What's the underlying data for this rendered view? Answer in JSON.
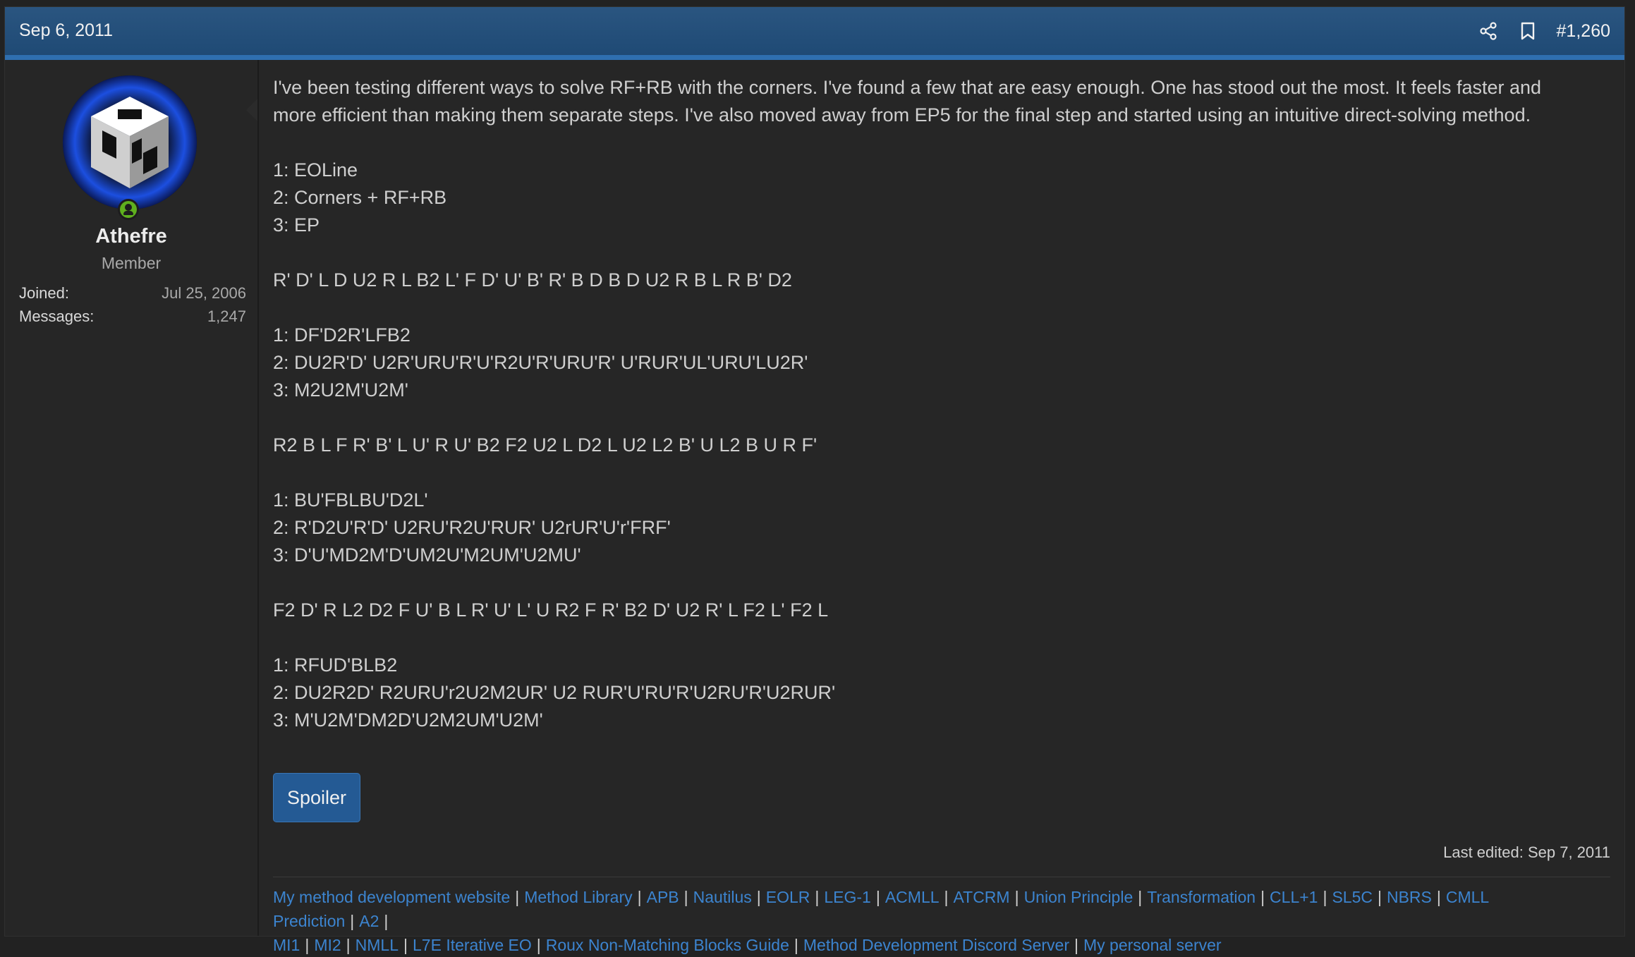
{
  "header": {
    "date": "Sep 6, 2011",
    "post_number": "#1,260",
    "share_icon": "share-icon",
    "bookmark_icon": "bookmark-icon",
    "bar_color": "#215080",
    "accent_color": "#2f6fb0"
  },
  "user": {
    "name": "Athefre",
    "title": "Member",
    "joined_label": "Joined:",
    "joined_value": "Jul 25, 2006",
    "messages_label": "Messages:",
    "messages_value": "1,247",
    "online_status_color": "#5fb01e"
  },
  "post": {
    "intro_line1": "I've been testing different ways to solve RF+RB with the corners. I've found a few that are easy enough. One has stood out the most. It feels faster and",
    "intro_line2": "more efficient than making them separate steps. I've also moved away from EP5 for the final step and started using an intuitive direct-solving method.",
    "steps": [
      "1: EOLine",
      "2: Corners + RF+RB",
      "3: EP"
    ],
    "examples": [
      {
        "scramble": "R' D' L D U2 R L B2 L' F D' U' B' R' B D B D U2 R B L R B' D2",
        "solution": [
          "1: DF'D2R'LFB2",
          "2: DU2R'D' U2R'URU'R'U'R2U'R'URU'R' U'RUR'UL'URU'LU2R'",
          "3: M2U2M'U2M'"
        ]
      },
      {
        "scramble": "R2 B L F R' B' L U' R U' B2 F2 U2 L D2 L U2 L2 B' U L2 B U R F'",
        "solution": [
          "1: BU'FBLBU'D2L'",
          "2: R'D2U'R'D' U2RU'R2U'RUR' U2rUR'U'r'FRF'",
          "3: D'U'MD2M'D'UM2U'M2UM'U2MU'"
        ]
      },
      {
        "scramble": "F2 D' R L2 D2 F U' B L R' U' L' U R2 F R' B2 D' U2 R' L F2 L' F2 L",
        "solution": [
          "1: RFUD'BLB2",
          "2: DU2R2D' R2URU'r2U2M2UR' U2 RUR'U'RU'R'U2RU'R'U2RUR'",
          "3: M'U2M'DM2D'U2M2UM'U2M'"
        ]
      }
    ],
    "spoiler_label": "Spoiler",
    "last_edited": "Last edited: Sep 7, 2011"
  },
  "signature": {
    "line1": [
      "My method development website",
      "Method Library",
      "APB",
      "Nautilus",
      "EOLR",
      "LEG-1",
      "ACMLL",
      "ATCRM",
      "Union Principle",
      "Transformation",
      "CLL+1",
      "SL5C",
      "NBRS",
      "CMLL Prediction",
      "A2"
    ],
    "line2": [
      "MI1",
      "MI2",
      "NMLL",
      "L7E Iterative EO",
      "Roux Non-Matching Blocks Guide",
      "Method Development Discord Server",
      "My personal server"
    ],
    "separator": "|",
    "link_color": "#3c84cf"
  }
}
